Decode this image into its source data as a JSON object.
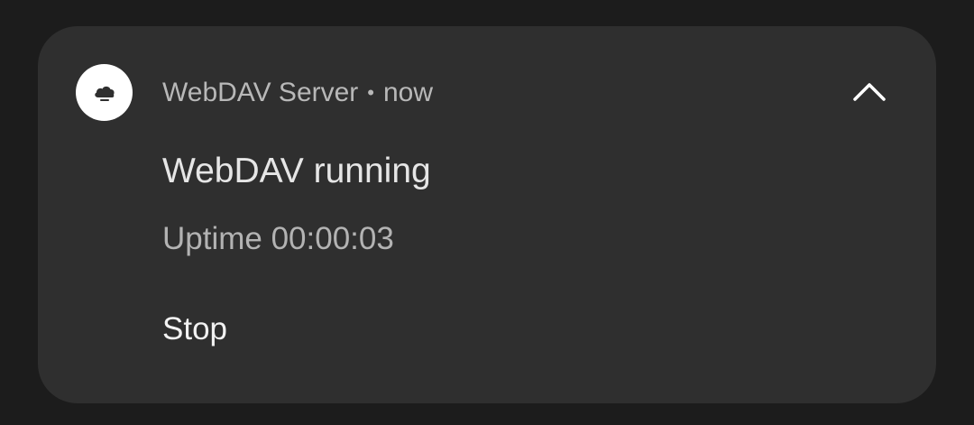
{
  "notification": {
    "app_name": "WebDAV Server",
    "separator": "•",
    "time": "now",
    "title": "WebDAV running",
    "subtitle": "Uptime 00:00:03",
    "app_icon": "cloud-icon",
    "expand_icon": "chevron-up-icon",
    "actions": [
      {
        "label": "Stop"
      }
    ]
  },
  "colors": {
    "background": "#1c1c1c",
    "card": "#2f2f2f",
    "icon_background": "#ffffff",
    "title_text": "#e6e6e6",
    "secondary_text": "#b3b3b3",
    "action_text": "#f2f2f2"
  }
}
